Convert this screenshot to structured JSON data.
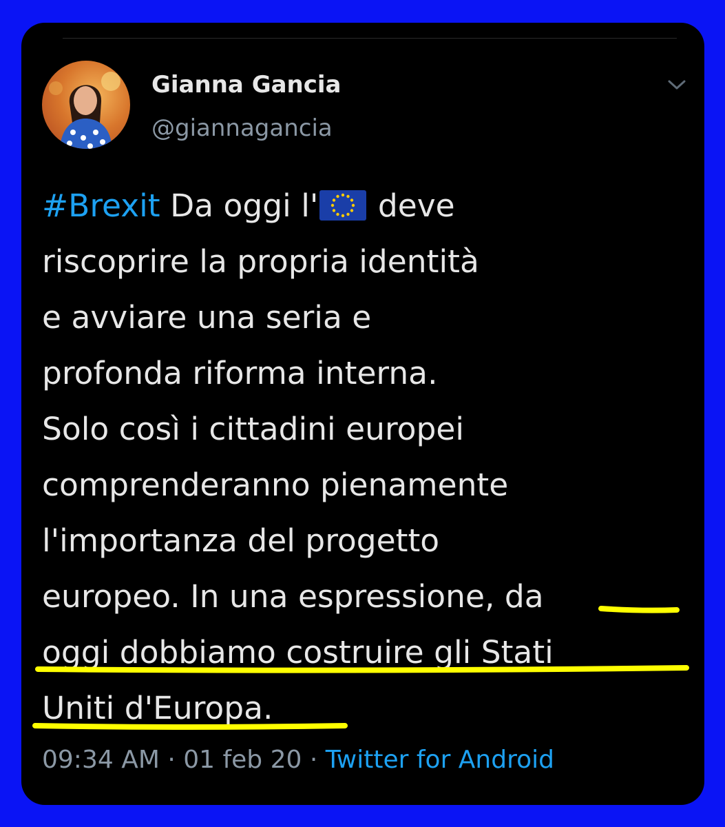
{
  "tweet": {
    "author": {
      "display_name": "Gianna Gancia",
      "handle": "@giannagancia"
    },
    "text": {
      "hashtag": "#Brexit",
      "line1_before_flag": " Da oggi l'",
      "flag_emoji": "EU flag",
      "line1_after_flag": " deve",
      "lines": [
        "riscoprire la propria identità",
        "e avviare una seria e",
        "profonda riforma interna.",
        "Solo così i cittadini europei",
        "comprenderanno pienamente",
        "l'importanza del progetto",
        "europeo. In una espressione, da",
        "oggi dobbiamo costruire gli Stati",
        "Uniti d'Europa."
      ]
    },
    "meta": {
      "time": "09:34 AM",
      "separator": " · ",
      "date": "01 feb 20",
      "source": "Twitter for Android"
    }
  },
  "colors": {
    "frame": "#0a14f5",
    "card": "#000000",
    "text": "#e7e7e7",
    "secondary": "#8b98a5",
    "link": "#1da1f2",
    "highlight": "#ffff00"
  },
  "icons": [
    "chevron-down-icon",
    "eu-flag-emoji"
  ]
}
